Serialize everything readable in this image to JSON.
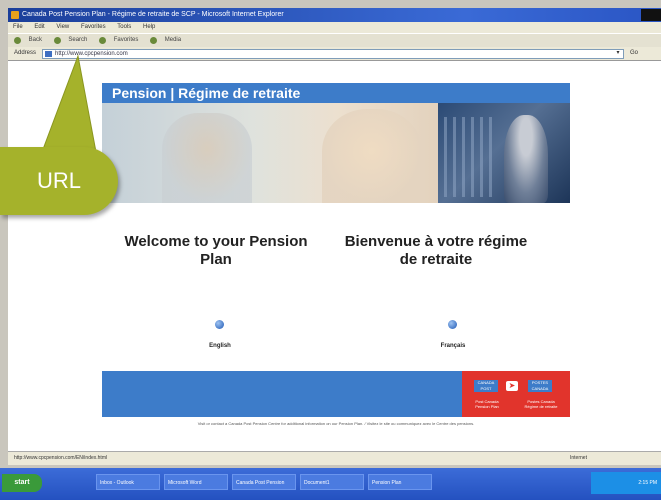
{
  "browser": {
    "window_title": "Canada Post Pension Plan - Régime de retraite de SCP - Microsoft Internet Explorer",
    "menu": [
      "File",
      "Edit",
      "View",
      "Favorites",
      "Tools",
      "Help"
    ],
    "toolbar": [
      "Back",
      "Search",
      "Favorites",
      "Media"
    ],
    "address_label": "Address",
    "address_value": "http://www.cpcpension.com",
    "go_label": "Go",
    "status_text": "http://www.cpcpension.com/EN/index.html",
    "status_zone": "Internet"
  },
  "page": {
    "banner_title": "Pension | Régime de retraite",
    "welcome_en": "Welcome to your Pension Plan",
    "welcome_fr": "Bienvenue à votre régime de retraite",
    "link_en": "English",
    "link_fr": "Français",
    "post_logo_left_box": "CANADA POST",
    "post_logo_right_box": "POSTES CANADA",
    "post_logo_left_text": "Post Canada Pension Plan",
    "post_logo_right_text": "Postes Canada Régime de retraite",
    "disclaimer": "Visit or contact a Canada Post Pension Centre for additional information on our Pension Plan. / Visitez le site ou communiquez avec le Centre des pensions."
  },
  "taskbar": {
    "start_label": "start",
    "items": [
      "Inbox - Outlook",
      "Microsoft Word",
      "Canada Post Pension",
      "Document1",
      "Pension Plan"
    ],
    "tray_time": "2:15 PM"
  },
  "callout": {
    "label": "URL",
    "color": "#a5b22b"
  }
}
